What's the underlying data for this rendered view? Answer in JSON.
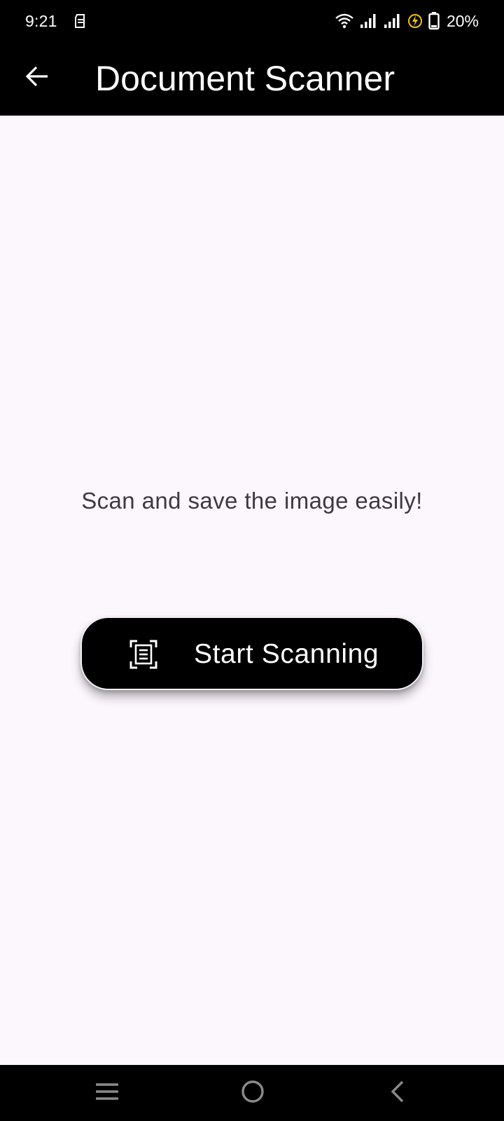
{
  "status_bar": {
    "time": "9:21",
    "battery": "20%",
    "icons": [
      "sim-card-icon",
      "wifi-icon",
      "signal-icon",
      "signal-icon",
      "charging-icon",
      "battery-icon"
    ]
  },
  "app_bar": {
    "title": "Document Scanner",
    "back_icon": "back-arrow-icon"
  },
  "main": {
    "tagline": "Scan and save the image easily!",
    "scan_button": {
      "label": "Start Scanning",
      "icon": "document-scan-icon"
    }
  },
  "nav_bar": {
    "buttons": [
      "menu-icon",
      "home-icon",
      "back-icon"
    ]
  },
  "colors": {
    "bar_background": "#000000",
    "page_background": "#fcf6fd",
    "text_on_dark": "#ffffff",
    "body_text": "#3d3a41",
    "charging_accent": "#f2c200"
  }
}
